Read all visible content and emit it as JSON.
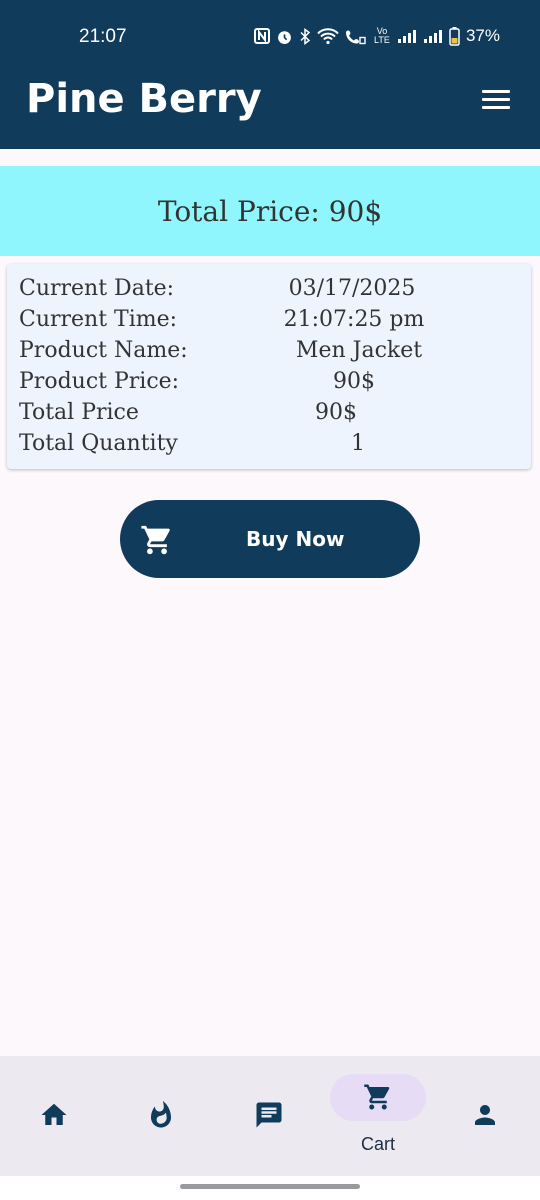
{
  "status_bar": {
    "time": "21:07",
    "battery_percent": "37%",
    "network_label": "Vo LTE"
  },
  "app_bar": {
    "title": "Pine Berry",
    "menu_icon": "hamburger-menu-icon"
  },
  "summary": {
    "total_price_text": "Total Price: 90$"
  },
  "details": [
    {
      "label": "Current Date:",
      "value": "03/17/2025"
    },
    {
      "label": "Current Time:",
      "value": "21:07:25 pm"
    },
    {
      "label": "Product Name:",
      "value": "Men Jacket"
    },
    {
      "label": "Product Price:",
      "value": "90$"
    },
    {
      "label": "Total Price",
      "value": "90$"
    },
    {
      "label": "Total Quantity",
      "value": "1"
    }
  ],
  "buy_button": {
    "label": "Buy Now",
    "icon": "cart-icon"
  },
  "bottom_nav": {
    "items": [
      {
        "icon": "home-icon",
        "label": ""
      },
      {
        "icon": "fire-icon",
        "label": ""
      },
      {
        "icon": "chat-icon",
        "label": ""
      },
      {
        "icon": "cart-icon",
        "label": "Cart",
        "active": true
      },
      {
        "icon": "person-icon",
        "label": ""
      }
    ]
  },
  "colors": {
    "primary": "#103b5b",
    "banner": "#8ef6fc",
    "card": "#eef4fd",
    "nav_bg": "#ece9f0",
    "nav_active_pill": "#e6dcf6"
  }
}
